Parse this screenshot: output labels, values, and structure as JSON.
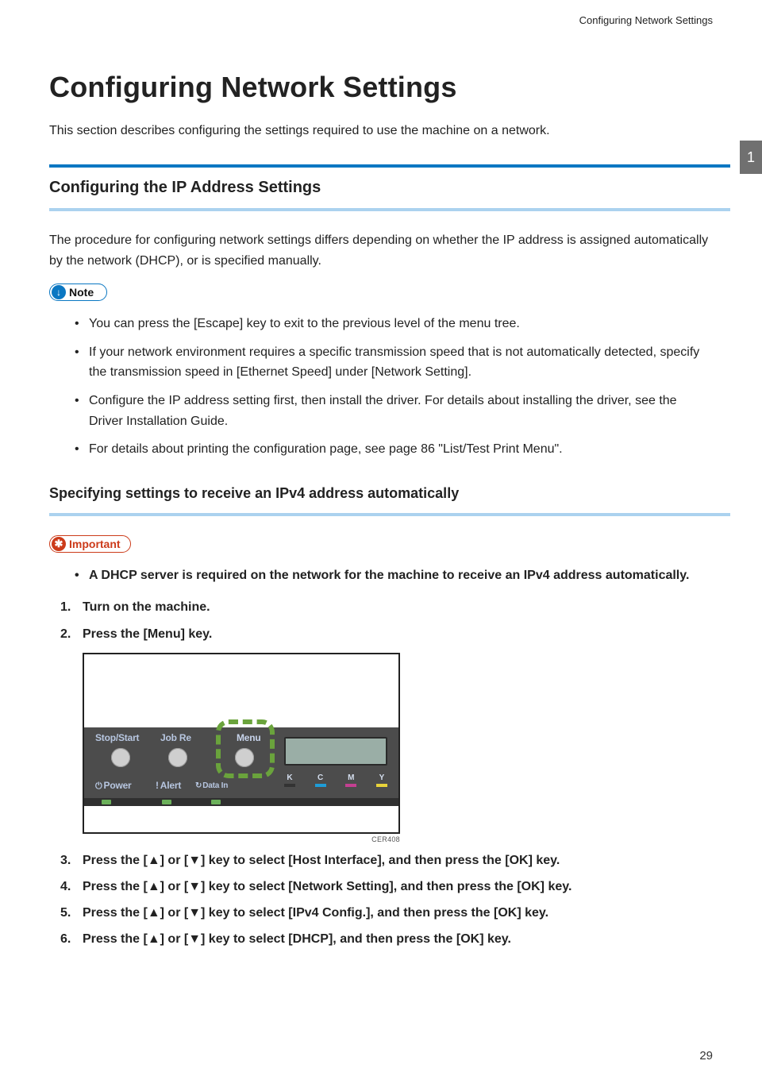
{
  "running_header": "Configuring Network Settings",
  "chapter_tab": "1",
  "page_number": "29",
  "h1": "Configuring Network Settings",
  "intro": "This section describes configuring the settings required to use the machine on a network.",
  "section1": {
    "title": "Configuring the IP Address Settings",
    "para": "The procedure for configuring network settings differs depending on whether the IP address is assigned automatically by the network (DHCP), or is specified manually.",
    "note_label": "Note",
    "note_items": [
      "You can press the [Escape] key to exit to the previous level of the menu tree.",
      "If your network environment requires a specific transmission speed that is not automatically detected, specify the transmission speed in [Ethernet Speed] under [Network Setting].",
      "Configure the IP address setting first, then install the driver. For details about installing the driver, see the Driver Installation Guide.",
      "For details about printing the configuration page, see page 86 \"List/Test Print Menu\"."
    ]
  },
  "section2": {
    "title": "Specifying settings to receive an IPv4 address automatically",
    "important_label": "Important",
    "important_items": [
      "A DHCP server is required on the network for the machine to receive an IPv4 address automatically."
    ],
    "steps_pre": [
      "Turn on the machine.",
      "Press the [Menu] key."
    ],
    "figure": {
      "labels": {
        "stopstart": "Stop/Start",
        "jobre": "Job Re",
        "menu": "Menu",
        "power": "Power",
        "alert": "Alert",
        "datain": "Data In"
      },
      "toners": [
        "K",
        "C",
        "M",
        "Y"
      ],
      "caption": "CER408"
    },
    "steps_post": [
      "Press the [▲] or [▼] key to select [Host Interface], and then press the [OK] key.",
      "Press the [▲] or [▼] key to select [Network Setting], and then press the [OK] key.",
      "Press the [▲] or [▼] key to select [IPv4 Config.], and then press the [OK] key.",
      "Press the [▲] or [▼] key to select [DHCP], and then press the [OK] key."
    ]
  }
}
